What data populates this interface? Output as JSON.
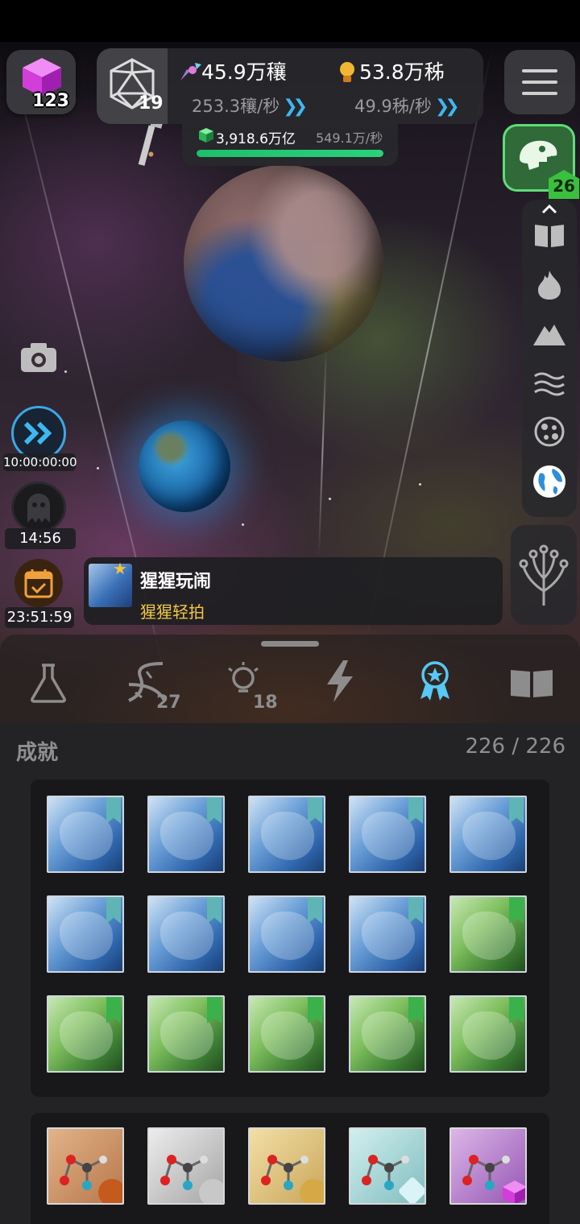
{
  "hud": {
    "gem_count": "123",
    "dice_count": "19",
    "resource_a": {
      "value": "45.9万穰",
      "rate": "253.3穰/秒"
    },
    "resource_b": {
      "value": "53.8万秭",
      "rate": "49.9秭/秒"
    },
    "sub_resource": {
      "value": "3,918.6万亿",
      "rate": "549.1万/秒",
      "progress": 1.0
    },
    "dino_level": "26"
  },
  "timers": {
    "speed": "10:00:00:00",
    "ghost": "14:56",
    "calendar": "23:51:59"
  },
  "toast": {
    "title": "猩猩玩闹",
    "subtitle": "猩猩轻拍"
  },
  "tabs": [
    {
      "name": "flask-icon",
      "count": ""
    },
    {
      "name": "dna-icon",
      "count": "27"
    },
    {
      "name": "lightbulb-icon",
      "count": "18"
    },
    {
      "name": "lightning-icon",
      "count": ""
    },
    {
      "name": "medal-icon",
      "count": "",
      "active": true
    },
    {
      "name": "book-icon",
      "count": ""
    }
  ],
  "section": {
    "title": "成就",
    "count": "226 / 226"
  },
  "side_menu": [
    "book-icon",
    "fire-icon",
    "mountain-icon",
    "waves-icon",
    "cells-icon",
    "globe-icon"
  ],
  "colors": {
    "accent_blue": "#3db8f0",
    "progress_green": "#2ad27b",
    "toast_subtitle": "#f1c645",
    "dino_green": "#5fdc78"
  }
}
